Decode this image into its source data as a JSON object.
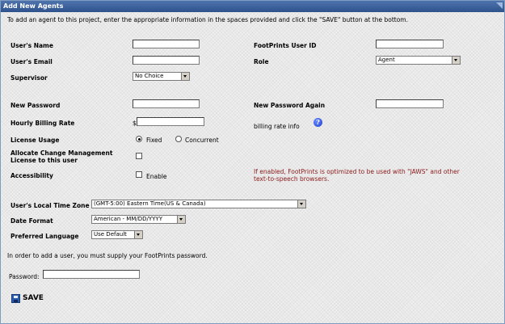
{
  "title": "Add New Agents",
  "intro": "To add an agent to this project, enter the appropriate information in the spaces provided and click the \"SAVE\" button at the bottom.",
  "fields": {
    "users_name": "User's Name",
    "footprints_user_id": "FootPrints User ID",
    "users_email": "User's Email",
    "role": "Role",
    "role_value": "Agent",
    "supervisor": "Supervisor",
    "supervisor_value": "No Choice",
    "new_password": "New Password",
    "new_password_again": "New Password Again",
    "hourly_billing_rate": "Hourly Billing Rate",
    "currency": "$",
    "billing_rate_info": "billing rate info",
    "license_usage": "License Usage",
    "license_fixed": "Fixed",
    "license_concurrent": "Concurrent",
    "allocate_cm_line1": "Allocate Change Management",
    "allocate_cm_line2": "License to this user",
    "accessibility": "Accessibility",
    "enable": "Enable",
    "accessibility_note_line1": "If enabled, FootPrints is optimized to be used with \"JAWS\" and other",
    "accessibility_note_line2": "text-to-speech browsers.",
    "time_zone": "User's Local Time Zone",
    "time_zone_value": "(GMT-5:00) Eastern Time(US & Canada)",
    "date_format": "Date Format",
    "date_format_value": "American - MM/DD/YYYY",
    "preferred_language": "Preferred Language",
    "preferred_language_value": "Use Default"
  },
  "password_prompt": "In order to add a user, you must supply your FootPrints password.",
  "password_label": "Password:",
  "save_label": "SAVE",
  "icons": {
    "info": "info-icon",
    "save": "floppy-disk-icon"
  },
  "info_glyph": "?",
  "colors": {
    "title_bar": "#2f528c",
    "note_text": "#8b1a1a",
    "info_icon": "#1d3fcf"
  }
}
